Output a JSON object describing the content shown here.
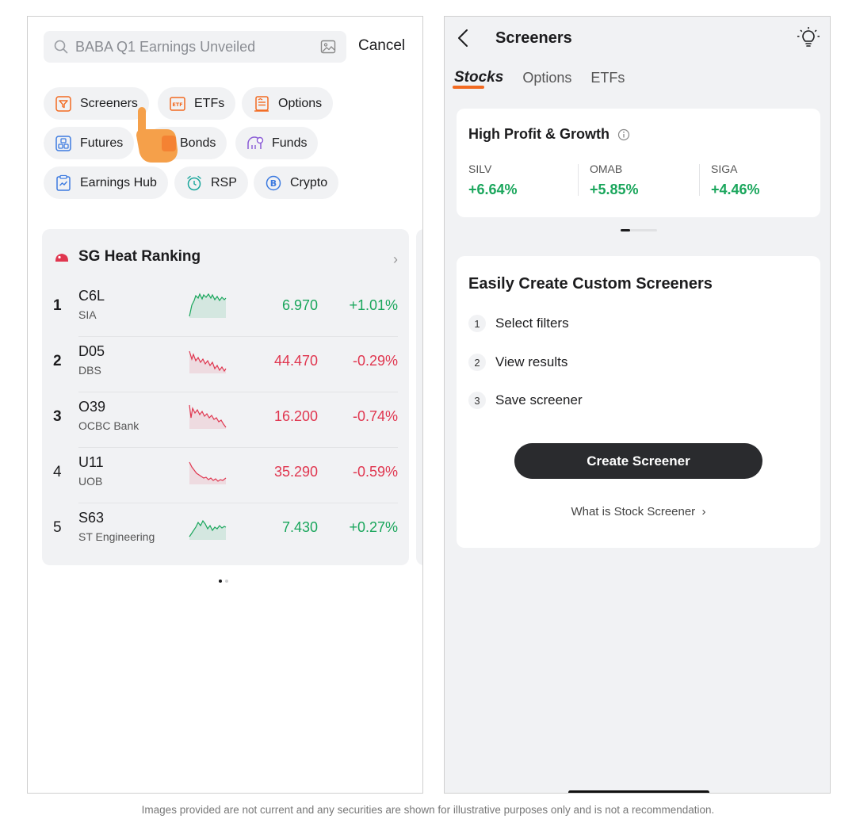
{
  "left_screen": {
    "search": {
      "placeholder": "BABA Q1 Earnings Unveiled",
      "search_icon": "search-icon",
      "image_icon": "image-search-icon"
    },
    "cancel_label": "Cancel",
    "chips": [
      {
        "label": "Screeners",
        "icon": "filter-icon"
      },
      {
        "label": "ETFs",
        "icon": "etf-icon"
      },
      {
        "label": "Options",
        "icon": "options-icon"
      },
      {
        "label": "Futures",
        "icon": "futures-icon"
      },
      {
        "label": "Bonds",
        "icon": "bonds-icon"
      },
      {
        "label": "Funds",
        "icon": "funds-icon"
      },
      {
        "label": "Earnings Hub",
        "icon": "earnings-icon"
      },
      {
        "label": "RSP",
        "icon": "clock-icon"
      },
      {
        "label": "Crypto",
        "icon": "bitcoin-icon"
      }
    ],
    "heat_ranking": {
      "title": "SG Heat Ranking",
      "rows": [
        {
          "rank": "1",
          "symbol": "C6L",
          "name": "SIA",
          "price": "6.970",
          "change": "+1.01%",
          "direction": "up"
        },
        {
          "rank": "2",
          "symbol": "D05",
          "name": "DBS",
          "price": "44.470",
          "change": "-0.29%",
          "direction": "down"
        },
        {
          "rank": "3",
          "symbol": "O39",
          "name": "OCBC Bank",
          "price": "16.200",
          "change": "-0.74%",
          "direction": "down"
        },
        {
          "rank": "4",
          "symbol": "U11",
          "name": "UOB",
          "price": "35.290",
          "change": "-0.59%",
          "direction": "down"
        },
        {
          "rank": "5",
          "symbol": "S63",
          "name": "ST Engineering",
          "price": "7.430",
          "change": "+0.27%",
          "direction": "up"
        }
      ]
    }
  },
  "right_screen": {
    "title": "Screeners",
    "tabs": [
      {
        "label": "Stocks",
        "active": true
      },
      {
        "label": "Options",
        "active": false
      },
      {
        "label": "ETFs",
        "active": false
      }
    ],
    "high_profit": {
      "title": "High Profit & Growth",
      "items": [
        {
          "symbol": "SILV",
          "change": "+6.64%"
        },
        {
          "symbol": "OMAB",
          "change": "+5.85%"
        },
        {
          "symbol": "SIGA",
          "change": "+4.46%"
        }
      ]
    },
    "custom": {
      "title": "Easily Create Custom Screeners",
      "steps": [
        {
          "n": "1",
          "text": "Select filters"
        },
        {
          "n": "2",
          "text": "View results"
        },
        {
          "n": "3",
          "text": "Save screener"
        }
      ],
      "button_label": "Create Screener",
      "link_label": "What is Stock Screener"
    }
  },
  "disclaimer": "Images provided are not current and any securities are shown for illustrative purposes only and is not a recommendation.",
  "colors": {
    "up": "#1aa65c",
    "down": "#e0364f",
    "accent": "#f26a21",
    "button": "#2a2b2e"
  }
}
